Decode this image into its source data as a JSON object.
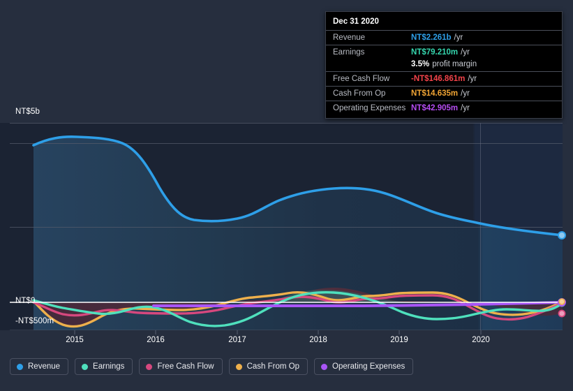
{
  "axis": {
    "y_labels": {
      "top": "NT$5b",
      "zero": "NT$0",
      "negative": "-NT$500m"
    },
    "x_ticks": [
      "2015",
      "2016",
      "2017",
      "2018",
      "2019",
      "2020"
    ]
  },
  "tooltip": {
    "title": "Dec 31 2020",
    "rows": [
      {
        "name": "Revenue",
        "value": "NT$2.261b",
        "unit": "/yr",
        "color": "#2e9fe8"
      },
      {
        "name": "Earnings",
        "value": "NT$79.210m",
        "unit": "/yr",
        "color": "#35d6ae"
      },
      {
        "name": "",
        "value": "3.5%",
        "unit": "profit margin",
        "color": "#ffffff"
      },
      {
        "name": "Free Cash Flow",
        "value": "-NT$146.861m",
        "unit": "/yr",
        "color": "#f4434a"
      },
      {
        "name": "Cash From Op",
        "value": "NT$14.635m",
        "unit": "/yr",
        "color": "#f0a434"
      },
      {
        "name": "Operating Expenses",
        "value": "NT$42.905m",
        "unit": "/yr",
        "color": "#b44cf0"
      }
    ]
  },
  "legend": {
    "items": [
      {
        "label": "Revenue",
        "color": "#2e9fe8"
      },
      {
        "label": "Earnings",
        "color": "#4fe0bd"
      },
      {
        "label": "Free Cash Flow",
        "color": "#d6487e"
      },
      {
        "label": "Cash From Op",
        "color": "#eeb04c"
      },
      {
        "label": "Operating Expenses",
        "color": "#a855f7"
      }
    ]
  },
  "colors": {
    "background": "#262e3e",
    "plot_light": "#24364d",
    "plot_dark": "#1b2333",
    "gridline": "#545b6b",
    "zero_line": "#ffffff"
  },
  "chart_data": {
    "type": "area",
    "title": "",
    "xlabel": "",
    "ylabel": "",
    "ylim": [
      -500000000,
      5000000000
    ],
    "grid": true,
    "legend_position": "bottom-left",
    "currency": "NT$",
    "x": [
      "2014.6",
      "2015",
      "2015.5",
      "2016",
      "2016.5",
      "2017",
      "2017.5",
      "2018",
      "2018.5",
      "2019",
      "2019.5",
      "2020",
      "2020.9"
    ],
    "series": [
      {
        "name": "Revenue",
        "color": "#2e9fe8",
        "values": [
          4400000000,
          4500000000,
          4480000000,
          3400000000,
          3150000000,
          3180000000,
          3480000000,
          3600000000,
          3560000000,
          3300000000,
          3000000000,
          2700000000,
          2261000000
        ]
      },
      {
        "name": "Earnings",
        "color": "#4fe0bd",
        "values": [
          30000000,
          -90000000,
          -170000000,
          -290000000,
          -180000000,
          -240000000,
          -60000000,
          120000000,
          150000000,
          60000000,
          -80000000,
          -150000000,
          79210000
        ]
      },
      {
        "name": "Free Cash Flow",
        "color": "#d6487e",
        "values": [
          -20000000,
          -130000000,
          -200000000,
          -230000000,
          -210000000,
          -120000000,
          40000000,
          120000000,
          230000000,
          260000000,
          60000000,
          -120000000,
          -146861000
        ]
      },
      {
        "name": "Cash From Op",
        "color": "#eeb04c",
        "values": [
          10000000,
          -250000000,
          -320000000,
          -230000000,
          -210000000,
          -140000000,
          60000000,
          150000000,
          260000000,
          300000000,
          80000000,
          -60000000,
          14635000
        ]
      },
      {
        "name": "Operating Expenses",
        "color": "#a855f7",
        "values": [
          null,
          null,
          null,
          40000000,
          42000000,
          42000000,
          42000000,
          42000000,
          42000000,
          42000000,
          42000000,
          42000000,
          42905000
        ]
      }
    ],
    "notes": {
      "zero_line": "NT$0 baseline drawn in white",
      "shaded_region_boundary": "vertical divider near 2020 separating reported vs latest period",
      "highlight_date": "Dec 31 2020"
    }
  }
}
